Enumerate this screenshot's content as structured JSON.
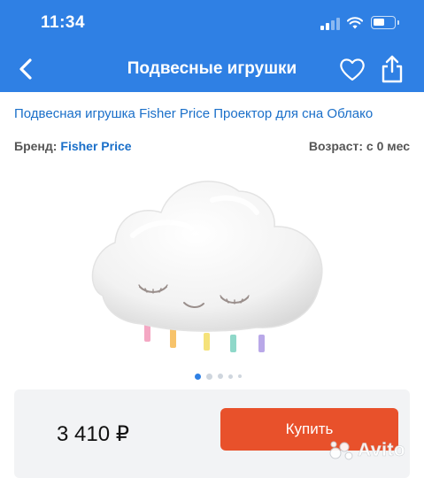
{
  "status_bar": {
    "time": "11:34",
    "icons": [
      "signal-icon",
      "wifi-icon",
      "battery-icon"
    ]
  },
  "header": {
    "title": "Подвесные игрушки",
    "back_icon": "chevron-left-icon",
    "favorite_icon": "heart-icon",
    "share_icon": "share-icon"
  },
  "product": {
    "title": "Подвесная игрушка Fisher Price Проектор для сна Облако",
    "brand_label": "Бренд:",
    "brand_value": "Fisher Price",
    "age_text": "Возраст: с 0 мес",
    "image": "white-cloud-plush-toy",
    "gallery": {
      "count": 5,
      "active_index": 0
    }
  },
  "purchase": {
    "price": "3 410 ₽",
    "buy_label": "Купить"
  },
  "watermark": {
    "text": "Avito"
  },
  "colors": {
    "header_bg": "#2f80e4",
    "link": "#1a6fc9",
    "buy_button": "#e8512b",
    "panel_bg": "#f2f3f5"
  }
}
